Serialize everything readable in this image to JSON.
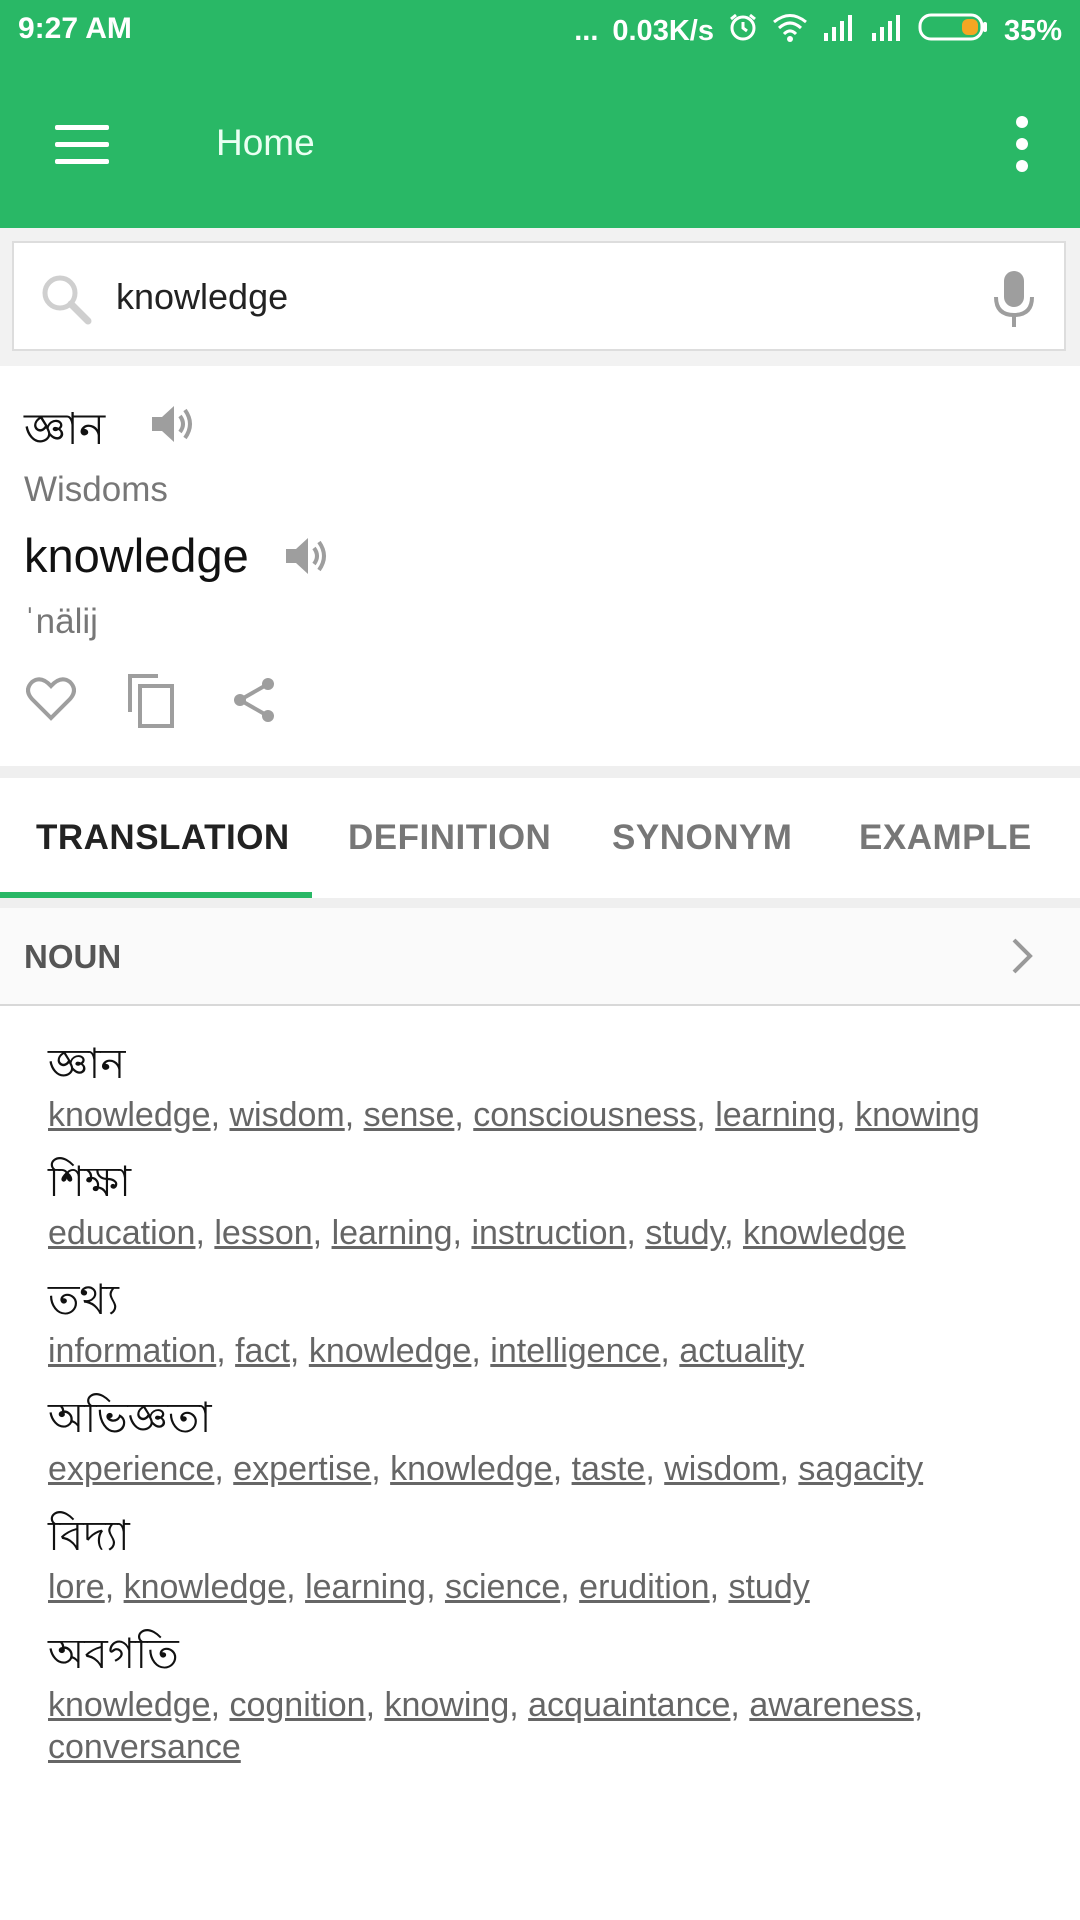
{
  "status_bar": {
    "time": "9:27 AM",
    "dots": "...",
    "speed": "0.03K/s",
    "battery": "35%",
    "icons": [
      "alarm-icon",
      "wifi-icon",
      "signal-icon",
      "signal-icon",
      "battery-icon"
    ]
  },
  "app_bar": {
    "title": "Home",
    "icons": [
      "menu-icon",
      "overflow-menu-icon"
    ]
  },
  "search": {
    "value": "knowledge",
    "placeholder": ""
  },
  "word_card": {
    "bengali": "জ্ঞান",
    "meaning": "Wisdoms",
    "english": "knowledge",
    "phonetic": "ˈnälij",
    "actions": [
      "heart-icon",
      "copy-icon",
      "share-icon"
    ]
  },
  "tabs": [
    {
      "label": "TRANSLATION",
      "active": true
    },
    {
      "label": "DEFINITION",
      "active": false
    },
    {
      "label": "SYNONYM",
      "active": false
    },
    {
      "label": "EXAMPLE",
      "active": false
    }
  ],
  "part_of_speech": "NOUN",
  "entries": [
    {
      "word": "জ্ঞান",
      "synonyms": [
        "knowledge",
        "wisdom",
        "sense",
        "consciousness",
        "learning",
        "knowing"
      ]
    },
    {
      "word": "শিক্ষা",
      "synonyms": [
        "education",
        "lesson",
        "learning",
        "instruction",
        "study",
        "knowledge"
      ]
    },
    {
      "word": "তথ্য",
      "synonyms": [
        "information",
        "fact",
        "knowledge",
        "intelligence",
        "actuality"
      ]
    },
    {
      "word": "অভিজ্ঞতা",
      "synonyms": [
        "experience",
        "expertise",
        "knowledge",
        "taste",
        "wisdom",
        "sagacity"
      ]
    },
    {
      "word": "বিদ্যা",
      "synonyms": [
        "lore",
        "knowledge",
        "learning",
        "science",
        "erudition",
        "study"
      ]
    },
    {
      "word": "অবগতি",
      "synonyms": [
        "knowledge",
        "cognition",
        "knowing",
        "acquaintance",
        "awareness",
        "conversance"
      ]
    }
  ],
  "colors": {
    "accent": "#29b866",
    "link": "#666666"
  }
}
